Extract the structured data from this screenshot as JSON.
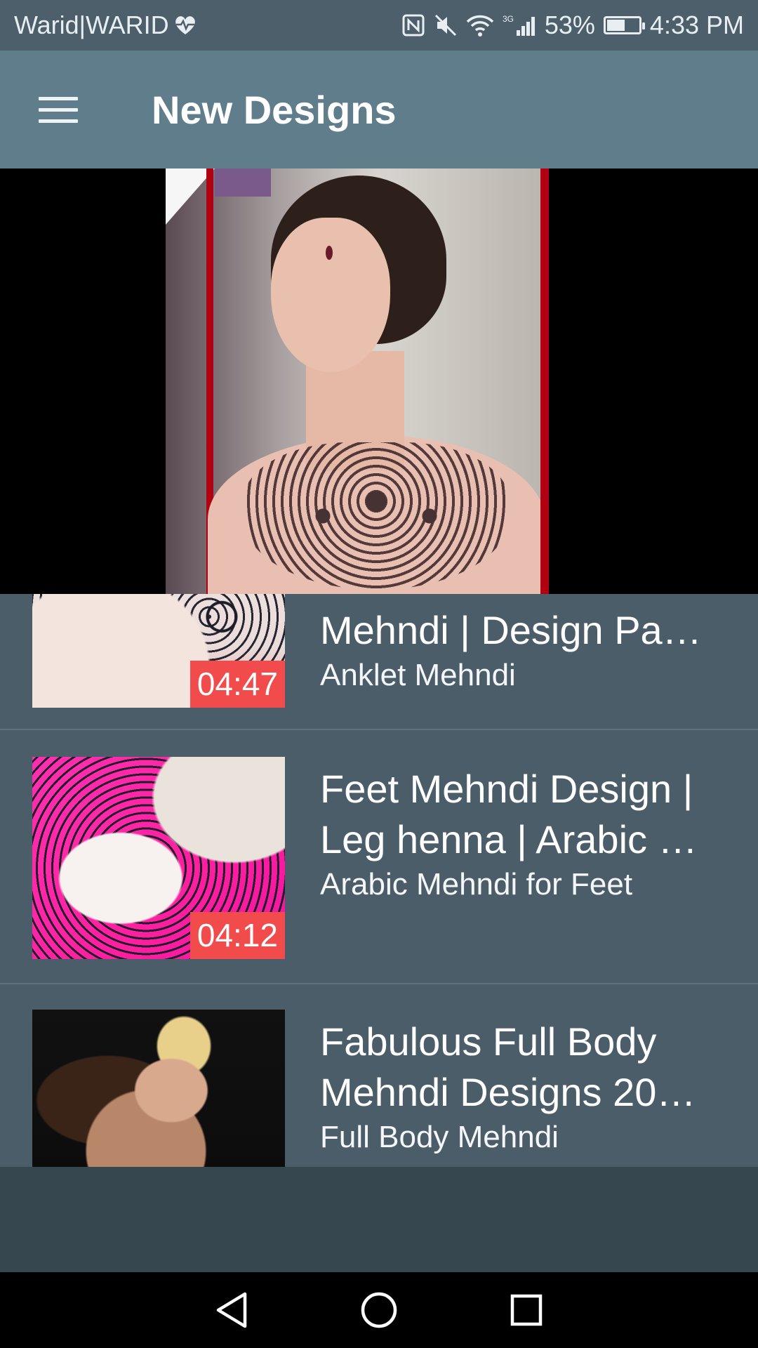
{
  "status_bar": {
    "carrier": "Warid|WARID",
    "network_type": "3G",
    "battery_percent": "53%",
    "battery_level": 0.53,
    "time": "4:33 PM",
    "icons": [
      "heart-monitor-icon",
      "nfc-icon",
      "mute-icon",
      "wifi-icon",
      "signal-icon",
      "battery-icon"
    ]
  },
  "app_bar": {
    "title": "New Designs",
    "menu_icon": "hamburger-menu-icon"
  },
  "player": {
    "state": "video-frame"
  },
  "videos": [
    {
      "title": "Mehndi | Design Pa…",
      "subtitle": "Anklet Mehndi",
      "duration": "04:47"
    },
    {
      "title": "Feet Mehndi Design | Leg henna | Arabic …",
      "subtitle": "Arabic Mehndi for Feet",
      "duration": "04:12"
    },
    {
      "title": "Fabulous Full Body Mehndi Designs 20…",
      "subtitle": "Full Body Mehndi",
      "duration": ""
    }
  ],
  "nav_bar": {
    "back_icon": "back-triangle-icon",
    "home_icon": "home-circle-icon",
    "recents_icon": "recents-square-icon"
  },
  "colors": {
    "status_bar": "#4d5f6b",
    "app_bar": "#607d8b",
    "list_bg": "#4b5d69",
    "duration_badge": "#f24b4b",
    "bottom_band": "#37474f",
    "nav_bar": "#000000"
  }
}
